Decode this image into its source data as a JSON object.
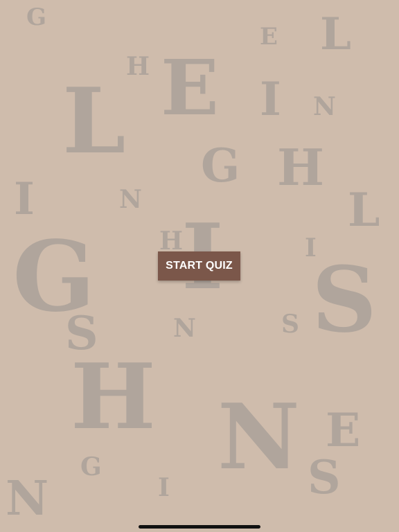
{
  "background_color": "#cfbcac",
  "letter_color": "#b0a59c",
  "button_color": "#7b574a",
  "background_letters": [
    "G",
    "E",
    "L",
    "H",
    "E",
    "L",
    "I",
    "N",
    "G",
    "H",
    "I",
    "N",
    "L",
    "H",
    "I",
    "G",
    "I",
    "S",
    "S",
    "N",
    "S",
    "H",
    "N",
    "E",
    "G",
    "S",
    "I",
    "N"
  ],
  "start_button": {
    "label": "START QUIZ"
  }
}
